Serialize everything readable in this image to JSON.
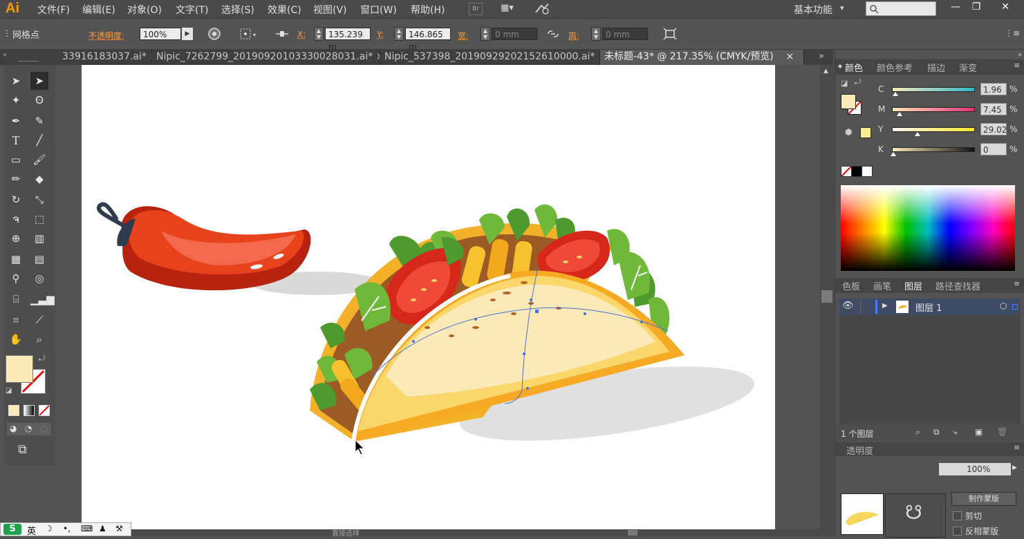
{
  "app": {
    "logo": "Ai",
    "menus": [
      "文件(F)",
      "编辑(E)",
      "对象(O)",
      "文字(T)",
      "选择(S)",
      "效果(C)",
      "视图(V)",
      "窗口(W)",
      "帮助(H)"
    ],
    "bridge_label": "Br",
    "workspace": "基本功能",
    "workspace_arrow": "▾",
    "search_placeholder": "",
    "window_controls": [
      "—",
      "❐",
      "✕"
    ]
  },
  "control_bar": {
    "selection_type": "网格点",
    "opacity_label": "不透明度:",
    "opacity_value": "100%",
    "x_label": "X:",
    "x_value": "135.239 m",
    "y_label": "Y:",
    "y_value": "146.865 m",
    "width_label": "宽:",
    "width_value": "0 mm",
    "height_label": "高:",
    "height_value": "0 mm"
  },
  "tabs": [
    {
      "label": "33916183037.ai*",
      "close": "×",
      "active": false
    },
    {
      "label": "Nipic_7262799_20190920103330028031.ai*",
      "close": "×",
      "active": false
    },
    {
      "label": "Nipic_537398_20190929202152610000.ai*",
      "close": "×",
      "active": false
    },
    {
      "label": "未标题-43* @ 217.35% (CMYK/预览)",
      "close": "×",
      "active": true
    }
  ],
  "color_panel": {
    "tabs": [
      "颜色",
      "颜色参考",
      "描边",
      "渐变"
    ],
    "channels": [
      {
        "name": "C",
        "value": "1.96",
        "unit": "%",
        "level": 0.02
      },
      {
        "name": "M",
        "value": "7.45",
        "unit": "%",
        "level": 0.07
      },
      {
        "name": "Y",
        "value": "29.02",
        "unit": "%",
        "level": 0.29
      },
      {
        "name": "K",
        "value": "0",
        "unit": "%",
        "level": 0.0
      }
    ],
    "fill_color": "#fbeab8"
  },
  "layers_panel": {
    "tabs": [
      "色板",
      "画笔",
      "图层",
      "路径查找器"
    ],
    "layers": [
      {
        "name": "图层 1"
      }
    ],
    "count": "1 个图层",
    "opacity_section": "透明度",
    "opacity_value": "100%",
    "make_mask": "制作蒙版",
    "clip": "剪切",
    "invert_mask": "反相蒙版"
  },
  "bottom": {
    "status": "直接选择",
    "ime": "英"
  }
}
